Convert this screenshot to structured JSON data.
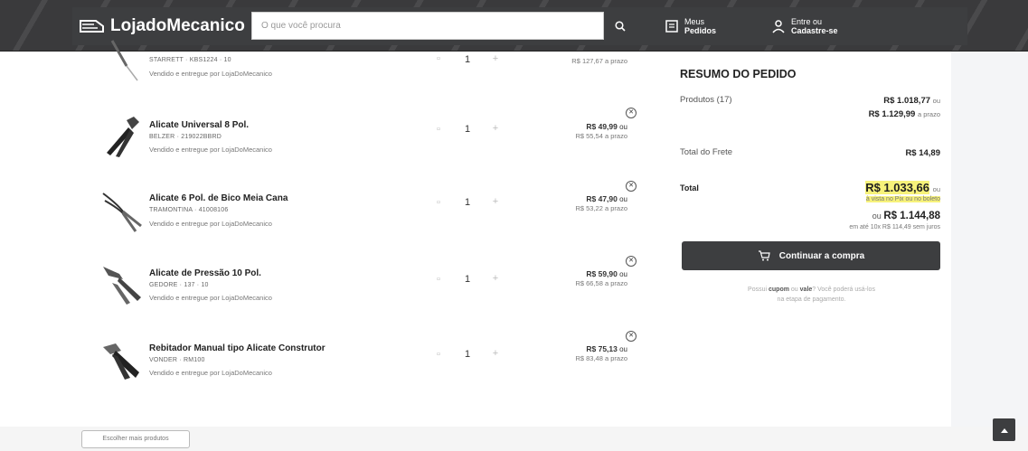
{
  "header": {
    "logo": "LojadoMecanico",
    "search_placeholder": "O que você procura",
    "orders_line1": "Meus",
    "orders_line2": "Pedidos",
    "account_line1": "Entre ou",
    "account_line2": "Cadastre-se"
  },
  "items": [
    {
      "name": "",
      "sku": "STARRETT · KBS1224 · 10",
      "seller": "Vendido e entregue por LojaDoMecanico",
      "qty": "1",
      "price": "",
      "price_sub": "R$ 127,67 a prazo"
    },
    {
      "name": "Alicate Universal 8 Pol.",
      "sku": "BELZER · 219022BBRD",
      "seller": "Vendido e entregue por LojaDoMecanico",
      "qty": "1",
      "price": "R$ 49,99",
      "price_suffix": "ou",
      "price_sub": "R$ 55,54 a prazo"
    },
    {
      "name": "Alicate 6 Pol. de Bico Meia Cana",
      "sku": "TRAMONTINA · 41008106",
      "seller": "Vendido e entregue por LojaDoMecanico",
      "qty": "1",
      "price": "R$ 47,90",
      "price_suffix": "ou",
      "price_sub": "R$ 53,22 a prazo"
    },
    {
      "name": "Alicate de Pressão 10 Pol.",
      "sku": "GEDORE · 137 · 10",
      "seller": "Vendido e entregue por LojaDoMecanico",
      "qty": "1",
      "price": "R$ 59,90",
      "price_suffix": "ou",
      "price_sub": "R$ 66,58 a prazo"
    },
    {
      "name": "Rebitador Manual tipo Alicate Construtor",
      "sku": "VONDER · RM100",
      "seller": "Vendido e entregue por LojaDoMecanico",
      "qty": "1",
      "price": "R$ 75,13",
      "price_suffix": "ou",
      "price_sub": "R$ 83,48 a prazo"
    }
  ],
  "summary": {
    "title": "RESUMO DO PEDIDO",
    "products_label": "Produtos (17)",
    "products_value": "R$ 1.018,77",
    "products_or": "ou",
    "products_installment": "R$ 1.129,99",
    "products_installment_suffix": "a prazo",
    "shipping_label": "Total do Frete",
    "shipping_value": "R$ 14,89",
    "total_label": "Total",
    "total_value": "R$ 1.033,66",
    "total_or": "ou",
    "total_note": "à vista no Pix ou no boleto",
    "total_alt_prefix": "ou",
    "total_alt_value": "R$ 1.144,88",
    "total_alt_note": "em até 10x R$ 114,49 sem juros",
    "buy_button": "Continuar a compra",
    "coupon_line1_a": "Possui",
    "coupon_line1_b": "cupom",
    "coupon_line1_c": "ou",
    "coupon_line1_d": "vale",
    "coupon_line1_e": "? Você poderá usá-los",
    "coupon_line2": "na etapa de pagamento."
  },
  "footer": {
    "more_products": "Escolher mais produtos"
  },
  "colors": {
    "header_bg": "#3d3e40",
    "highlight": "#f7f27a",
    "button": "#3d3e40"
  }
}
